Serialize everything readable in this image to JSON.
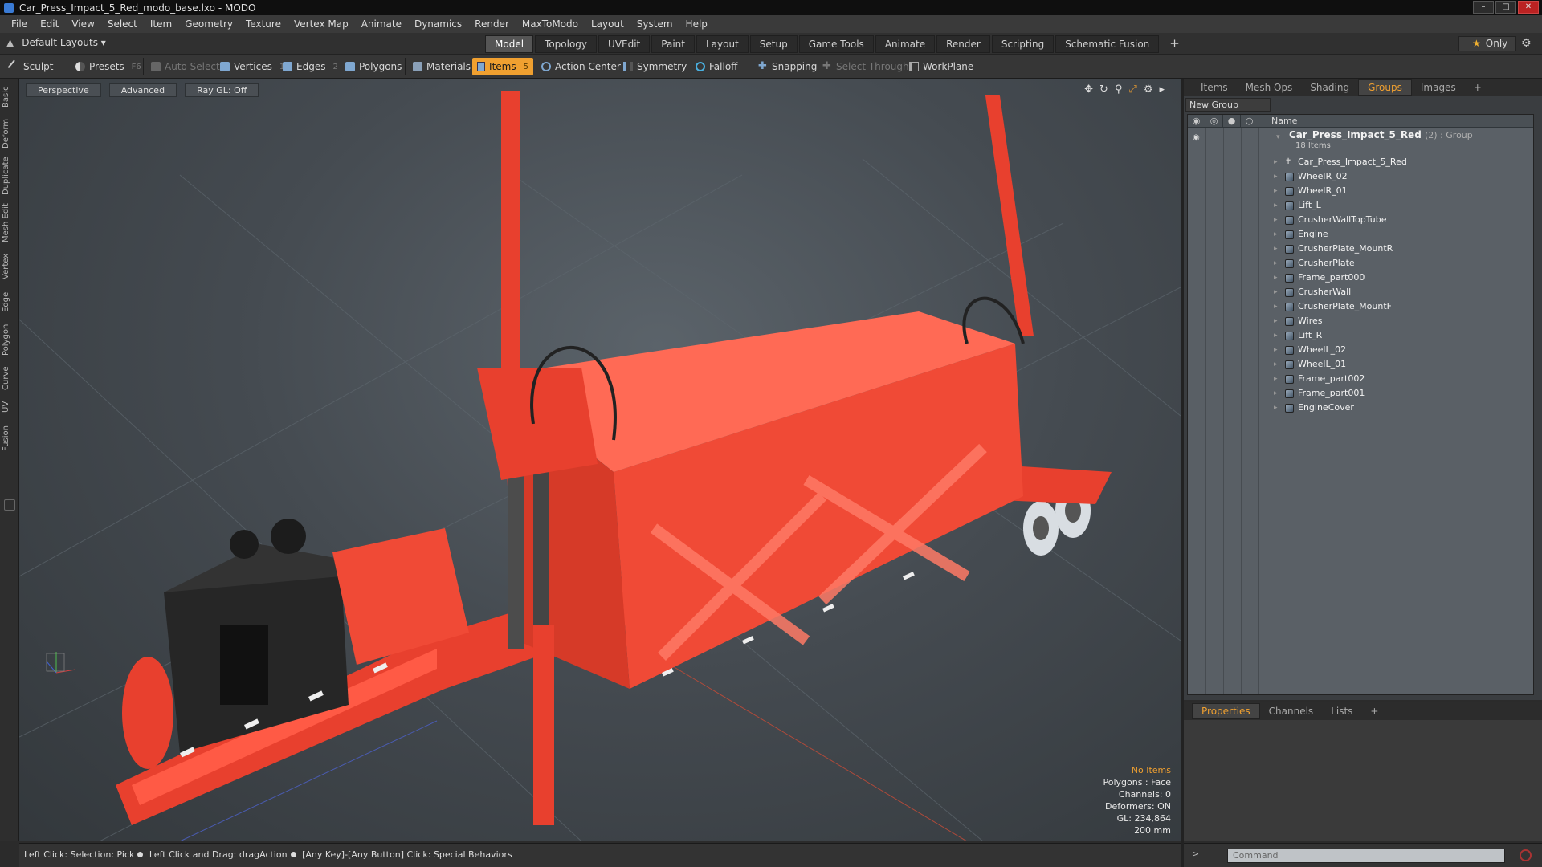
{
  "window": {
    "title": "Car_Press_Impact_5_Red_modo_base.lxo - MODO",
    "buttons": [
      "–",
      "□",
      "✕"
    ]
  },
  "menu": [
    "File",
    "Edit",
    "View",
    "Select",
    "Item",
    "Geometry",
    "Texture",
    "Vertex Map",
    "Animate",
    "Dynamics",
    "Render",
    "MaxToModo",
    "Layout",
    "System",
    "Help"
  ],
  "layout": {
    "selector": "Default Layouts ▾",
    "tabs": [
      "Model",
      "Topology",
      "UVEdit",
      "Paint",
      "Layout",
      "Setup",
      "Game Tools",
      "Animate",
      "Render",
      "Scripting",
      "Schematic Fusion"
    ],
    "active_tab": "Model",
    "plus": "+",
    "only_label": "Only"
  },
  "toolbar": {
    "sculpt": "Sculpt",
    "presets": "Presets",
    "presets_key": "F6",
    "auto_select": "Auto Select",
    "vertices": "Vertices",
    "vertices_count": "1",
    "edges": "Edges",
    "edges_count": "2",
    "polygons": "Polygons",
    "materials": "Materials",
    "items": "Items",
    "items_count": "5",
    "action_center": "Action Center",
    "symmetry": "Symmetry",
    "falloff": "Falloff",
    "snapping": "Snapping",
    "select_through": "Select Through",
    "workplane": "WorkPlane"
  },
  "left_tabs": [
    "Basic",
    "Deform",
    "Duplicate",
    "Mesh Edit",
    "Vertex",
    "Edge",
    "Polygon",
    "Curve",
    "UV",
    "Fusion"
  ],
  "viewport": {
    "view_mode": "Perspective",
    "shading": "Advanced",
    "raygl": "Ray GL: Off",
    "info": {
      "selection": "No Items",
      "polygons": "Polygons : Face",
      "channels": "Channels: 0",
      "deformers": "Deformers: ON",
      "gl": "GL: 234,864",
      "scale": "200 mm"
    }
  },
  "right_panel": {
    "tabs": [
      "Items",
      "Mesh Ops",
      "Shading",
      "Groups",
      "Images",
      "+"
    ],
    "active_tab": "Groups",
    "new_group": "New Group",
    "column_name": "Name",
    "group": {
      "name": "Car_Press_Impact_5_Red",
      "meta": "(2) : Group",
      "count": "18 Items"
    },
    "items": [
      "Car_Press_Impact_5_Red",
      "WheelR_02",
      "WheelR_01",
      "Lift_L",
      "CrusherWallTopTube",
      "Engine",
      "CrusherPlate_MountR",
      "CrusherPlate",
      "Frame_part000",
      "CrusherWall",
      "CrusherPlate_MountF",
      "Wires",
      "Lift_R",
      "WheelL_02",
      "WheelL_01",
      "Frame_part002",
      "Frame_part001",
      "EngineCover"
    ]
  },
  "props_panel": {
    "tabs": [
      "Properties",
      "Channels",
      "Lists",
      "+"
    ],
    "active_tab": "Properties"
  },
  "status": {
    "part1": "Left Click: Selection: Pick",
    "part2": "Left Click and Drag: dragAction",
    "part3": "[Any Key]-[Any Button] Click: Special Behaviors"
  },
  "command": {
    "placeholder": "Command",
    "arrow": ">"
  },
  "colors": {
    "accent": "#f0a030",
    "model_red": "#f04030"
  }
}
